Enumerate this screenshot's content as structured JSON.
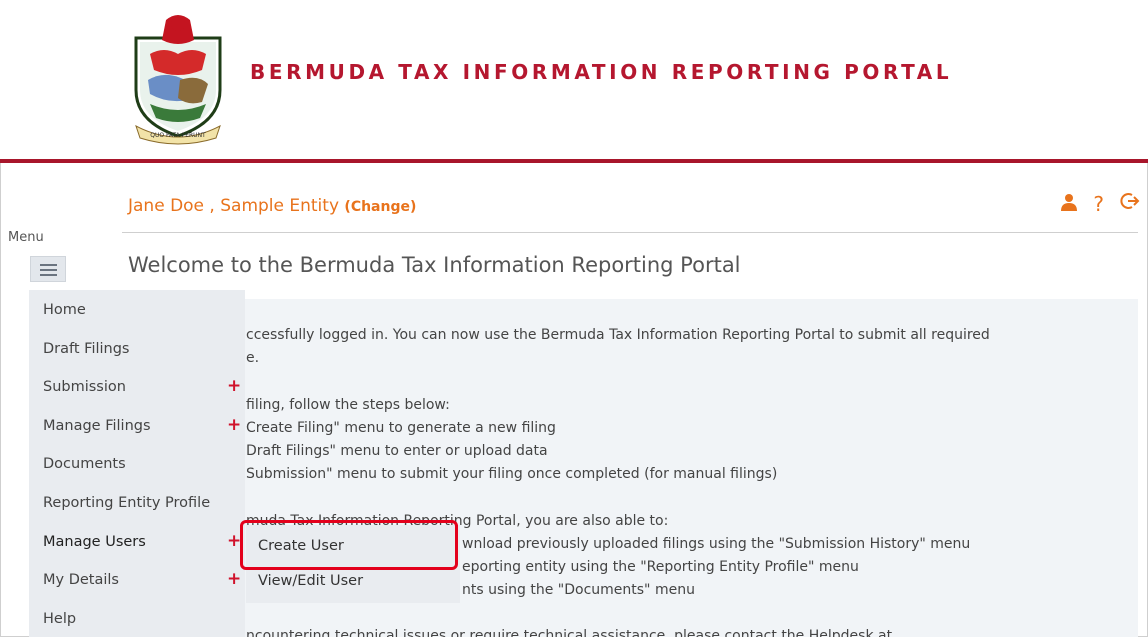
{
  "header": {
    "title": "BERMUDA TAX INFORMATION REPORTING PORTAL",
    "crest_motto": "QUO FATA FERUNT"
  },
  "user": {
    "name_entity": "Jane Doe , Sample Entity ",
    "change_label": "(Change)"
  },
  "top_icons": [
    "user-icon",
    "help-icon",
    "logout-icon"
  ],
  "menu": {
    "label": "Menu",
    "items": [
      {
        "label": "Home"
      },
      {
        "label": "Draft Filings"
      },
      {
        "label": "Submission"
      },
      {
        "label": "Manage Filings"
      },
      {
        "label": "Documents"
      },
      {
        "label": "Reporting Entity Profile"
      },
      {
        "label": "Manage Users"
      },
      {
        "label": "My Details"
      },
      {
        "label": "Help"
      }
    ],
    "submenu": {
      "create_user": "Create User",
      "view_edit_user": "View/Edit User"
    }
  },
  "main": {
    "heading": "Welcome to the Bermuda Tax Information Reporting Portal",
    "lines": [
      "ccessfully logged in. You can now use the Bermuda Tax Information Reporting Portal to submit all required",
      "e.",
      " filing, follow the steps below:",
      "Create Filing\" menu to generate a new filing",
      "Draft Filings\" menu to enter or upload data",
      "Submission\" menu to submit your filing once completed (for manual filings)",
      "muda Tax Information Reporting Portal, you are also able to:",
      "wnload previously uploaded filings using the \"Submission History\" menu",
      "eporting entity using the \"Reporting Entity Profile\" menu",
      "nts using the \"Documents\" menu",
      "ncountering technical issues or require technical assistance, please contact the Helpdesk at"
    ]
  },
  "colors": {
    "brand_red": "#b5172f",
    "accent_orange": "#e8731c",
    "plus_red": "#d0122b",
    "highlight_red": "#e3001b"
  }
}
